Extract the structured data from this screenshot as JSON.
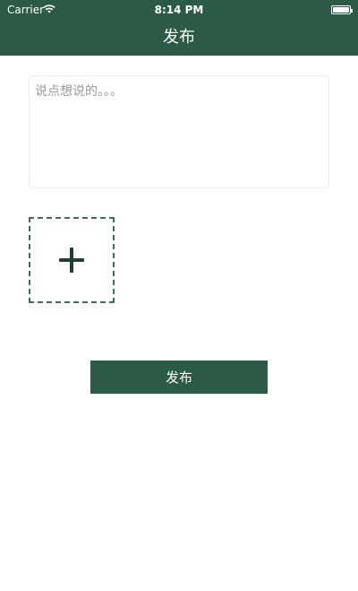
{
  "status_bar": {
    "carrier": "Carrier",
    "time": "8:14 PM",
    "icons": [
      "wifi-icon",
      "battery-icon"
    ]
  },
  "header": {
    "title": "发布",
    "background_color": "#2b5b44"
  },
  "composer": {
    "placeholder": "说点想说的。。。",
    "value": ""
  },
  "add_image": {
    "icon": "plus-icon"
  },
  "publish_button": {
    "label": "发布",
    "color": "#2b5b44"
  }
}
